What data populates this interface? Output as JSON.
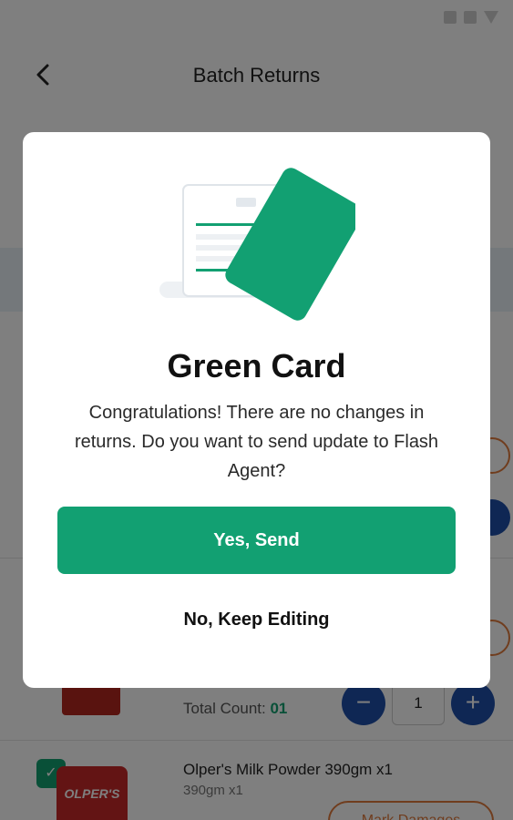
{
  "header": {
    "title": "Batch Returns"
  },
  "items": [
    {
      "total_count_label": "Total Count:",
      "total_count_value": "01",
      "quantity": "1"
    },
    {
      "name": "Olper's Milk Powder 390gm x1",
      "subtitle": "390gm x1",
      "brand_text": "OLPER'S",
      "mark_damages_label": "Mark Damages"
    }
  ],
  "modal": {
    "title": "Green Card",
    "message": "Congratulations! There are no changes in returns. Do you want to send update to Flash Agent?",
    "primary_label": "Yes, Send",
    "secondary_label": "No, Keep Editing"
  },
  "colors": {
    "accent_green": "#12a072",
    "stepper_blue": "#1e4fa8",
    "damage_orange": "#e07b3d"
  }
}
